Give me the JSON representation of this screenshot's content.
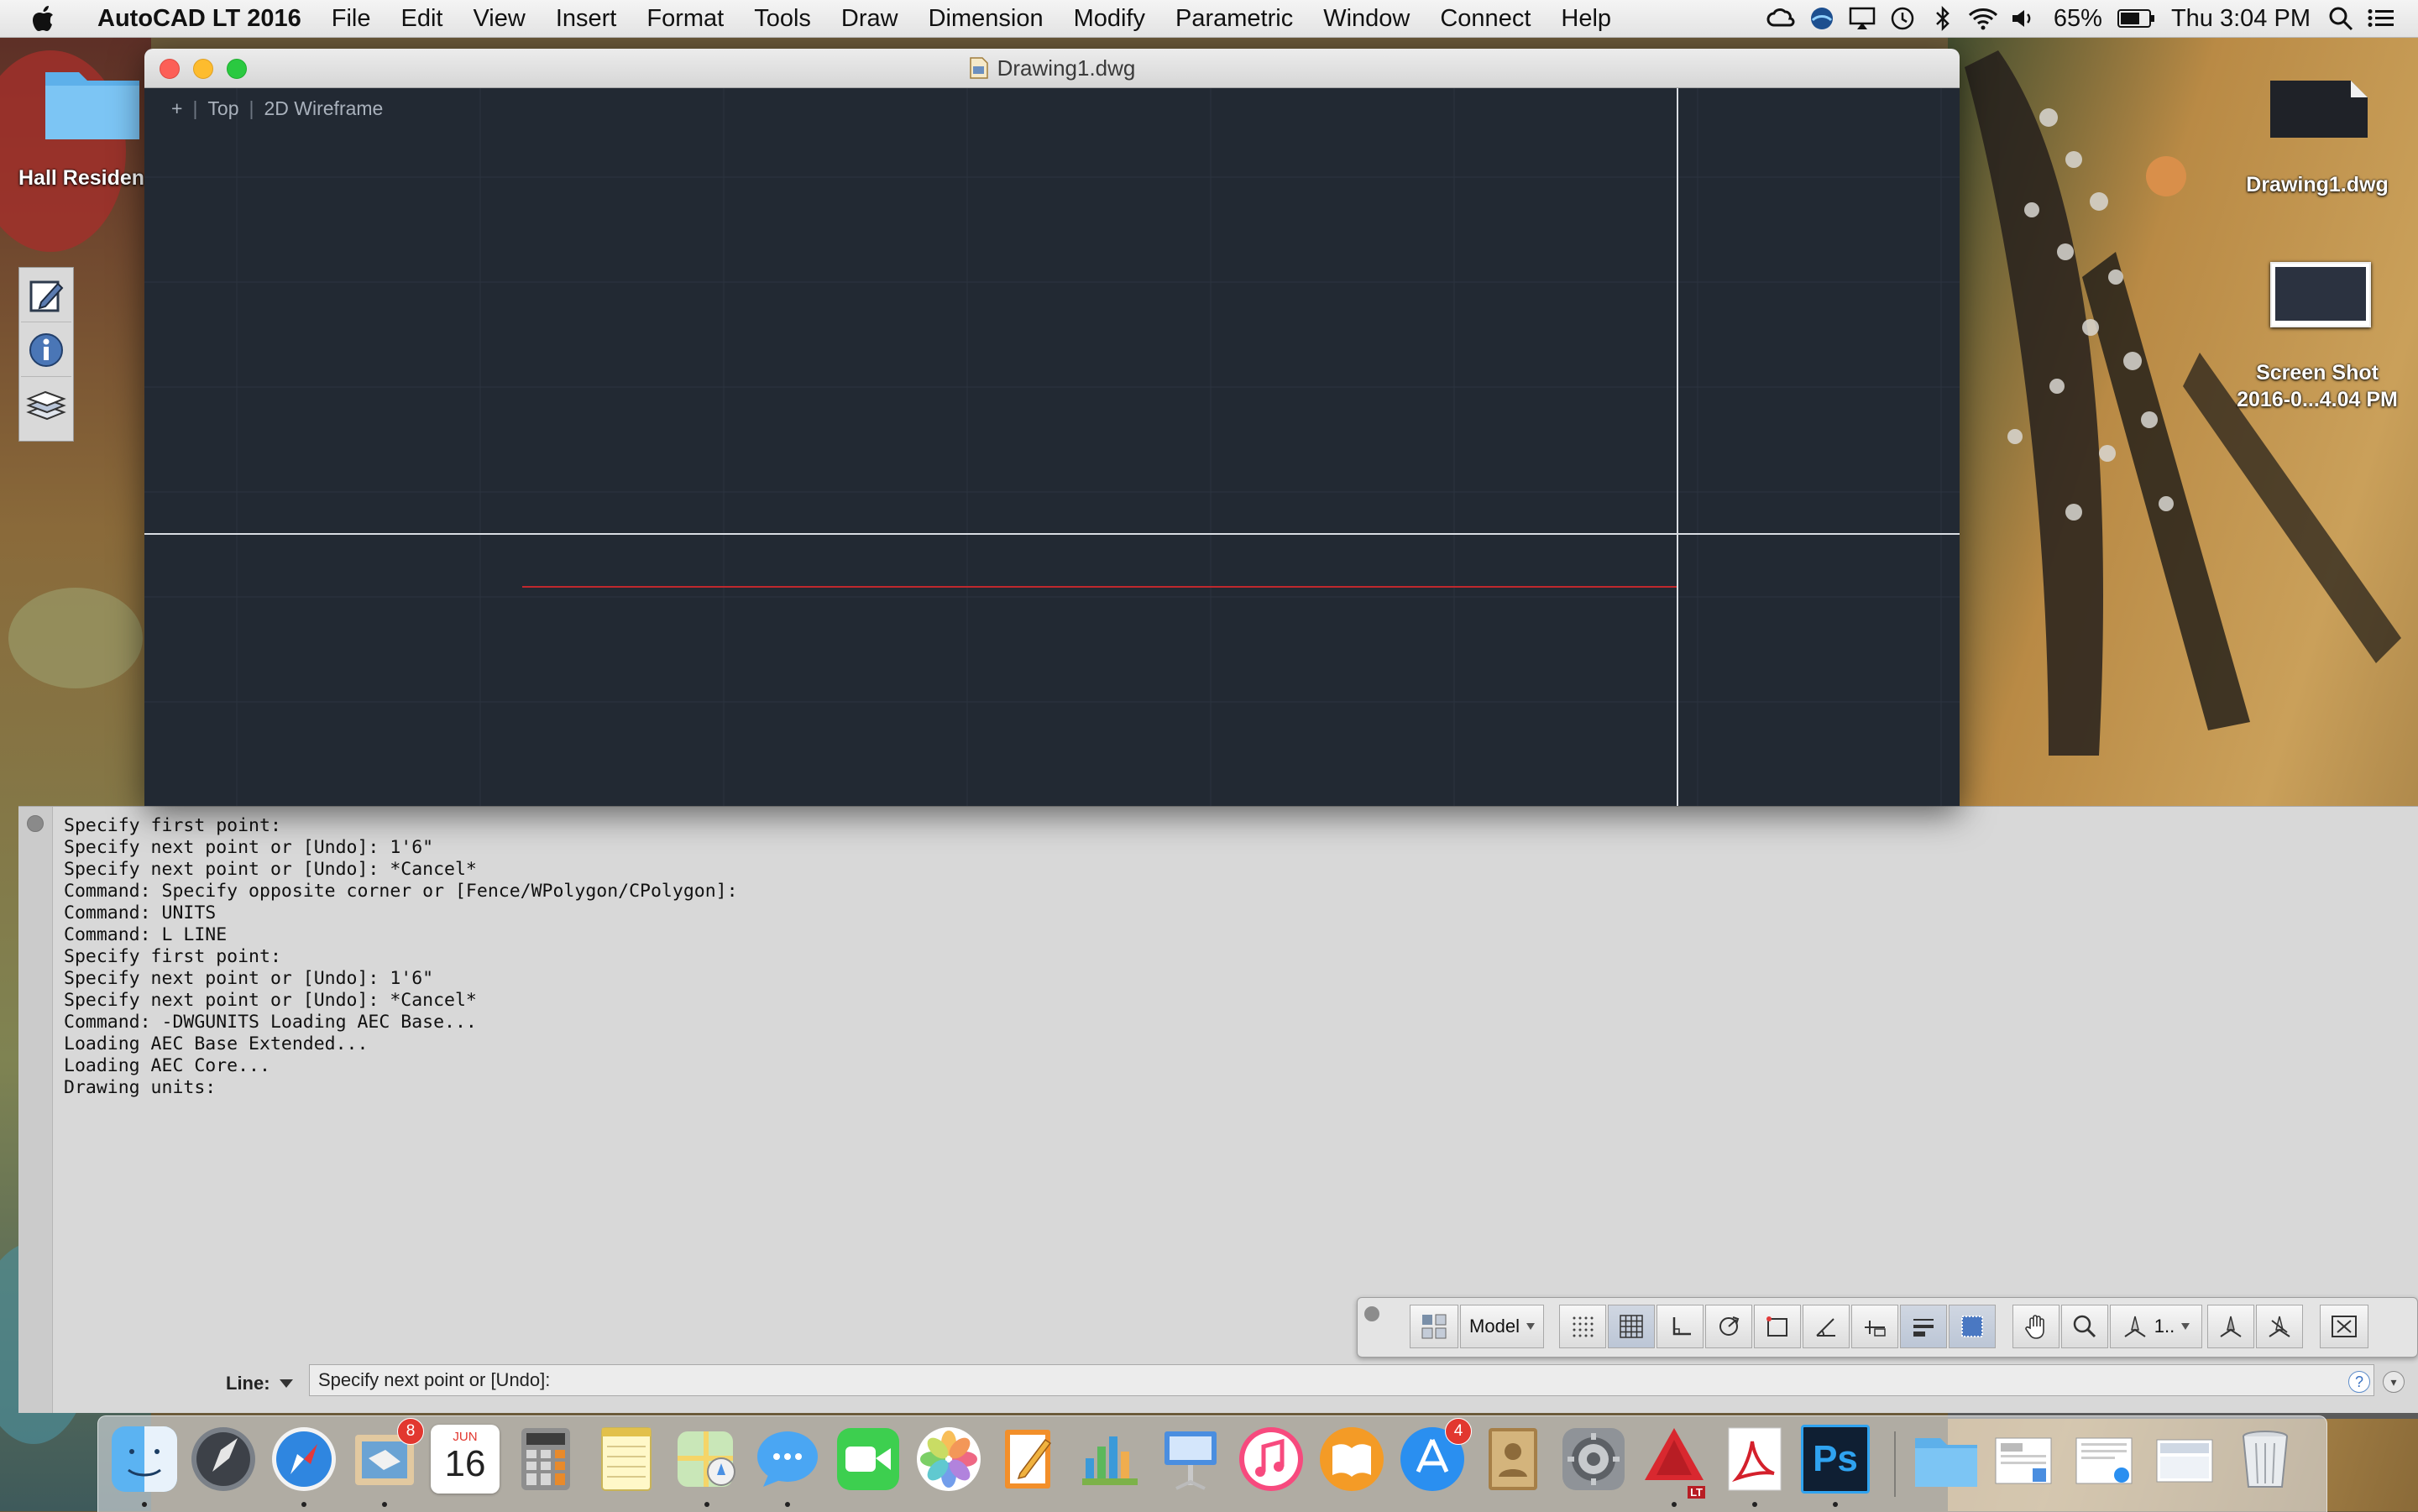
{
  "menubar": {
    "app_name": "AutoCAD LT 2016",
    "items": [
      "File",
      "Edit",
      "View",
      "Insert",
      "Format",
      "Tools",
      "Draw",
      "Dimension",
      "Modify",
      "Parametric",
      "Window",
      "Connect",
      "Help"
    ],
    "battery": "65%",
    "clock": "Thu 3:04 PM"
  },
  "desktop": {
    "folder_label": "Hall Residen",
    "file_label": "Drawing1.dwg",
    "screenshot_label_1": "Screen Shot",
    "screenshot_label_2": "2016-0...4.04 PM"
  },
  "window": {
    "title": "Drawing1.dwg",
    "viewport": {
      "plus": "+",
      "view": "Top",
      "style": "2D Wireframe"
    }
  },
  "command": {
    "history": [
      "Specify first point:",
      "Specify next point or [Undo]: 1'6\"",
      "Specify next point or [Undo]: *Cancel*",
      "Command: Specify opposite corner or [Fence/WPolygon/CPolygon]:",
      "Command: UNITS",
      "Command: L LINE",
      "Specify first point:",
      "Specify next point or [Undo]: 1'6\"",
      "Specify next point or [Undo]: *Cancel*",
      "Command: -DWGUNITS Loading AEC Base...",
      "Loading AEC Base Extended...",
      "Loading AEC Core...",
      "Drawing units:"
    ],
    "prompt_label": "Line:",
    "input_text": "Specify next point or [Undo]:",
    "help": "?"
  },
  "status_toolbar": {
    "model_label": "Model",
    "scale_label": "1.."
  },
  "dock": {
    "mail_badge": "8",
    "calendar_month": "JUN",
    "calendar_day": "16",
    "appstore_badge": "4",
    "acad_lt": "LT",
    "ps_label": "Ps"
  },
  "colors": {
    "canvas": "#222933",
    "crosshair": "#d9dde3",
    "drawn_line": "#c0282d",
    "command_bg": "#d8d8d8"
  }
}
